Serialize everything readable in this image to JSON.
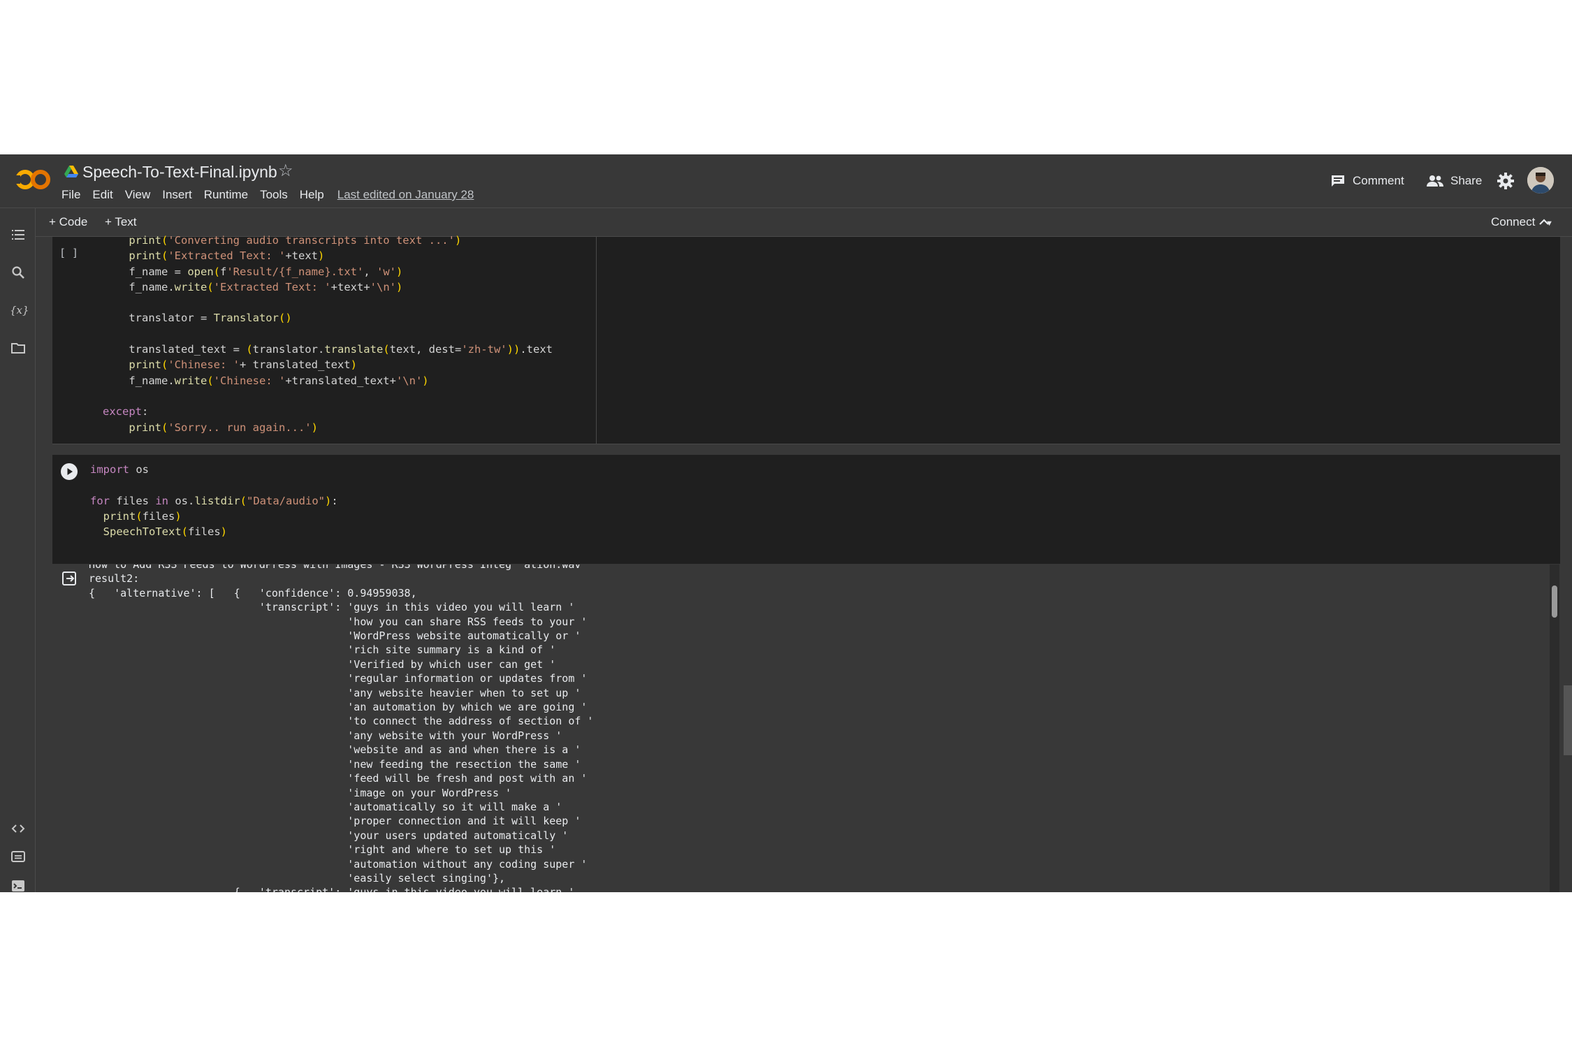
{
  "header": {
    "title": "Speech-To-Text-Final.ipynb",
    "menu": [
      "File",
      "Edit",
      "View",
      "Insert",
      "Runtime",
      "Tools",
      "Help"
    ],
    "last_edited": "Last edited on January 28",
    "comment_label": "Comment",
    "share_label": "Share"
  },
  "toolbar": {
    "code_label": "+ Code",
    "text_label": "+ Text",
    "connect_label": "Connect"
  },
  "cells": {
    "cell1_bracket": "[ ]",
    "cell1_lines": [
      "    print('Converting audio transcripts into text ...')",
      "    print('Extracted Text: '+text)",
      "    f_name = open(f'Result/{f_name}.txt', 'w')",
      "    f_name.write('Extracted Text: '+text+'\\n')",
      "",
      "    translator = Translator()",
      "",
      "    translated_text = (translator.translate(text, dest='zh-tw')).text",
      "    print('Chinese: '+ translated_text)",
      "    f_name.write('Chinese: '+translated_text+'\\n')",
      "",
      "except:",
      "    print('Sorry.. run again...')"
    ],
    "cell2_lines": [
      "import os",
      "",
      "for files in os.listdir(\"Data/audio\"):",
      "  print(files)",
      "  SpeechToText(files)"
    ]
  },
  "output": {
    "lines": [
      "How to Add RSS Feeds to WordPress with Images - RSS WordPress Integ  ation.wav",
      "result2:",
      "{   'alternative': [   {   'confidence': 0.94959038,",
      "                           'transcript': 'guys in this video you will learn '",
      "                                         'how you can share RSS feeds to your '",
      "                                         'WordPress website automatically or '",
      "                                         'rich site summary is a kind of '",
      "                                         'Verified by which user can get '",
      "                                         'regular information or updates from '",
      "                                         'any website heavier when to set up '",
      "                                         'an automation by which we are going '",
      "                                         'to connect the address of section of '",
      "                                         'any website with your WordPress '",
      "                                         'website and as and when there is a '",
      "                                         'new feeding the resection the same '",
      "                                         'feed will be fresh and post with an '",
      "                                         'image on your WordPress '",
      "                                         'automatically so it will make a '",
      "                                         'proper connection and it will keep '",
      "                                         'your users updated automatically '",
      "                                         'right and where to set up this '",
      "                                         'automation without any coding super '",
      "                                         'easily select singing'},",
      "                       {   'transcript': 'guys in this video you will learn '"
    ]
  },
  "colors": {
    "background": "#383838",
    "cell_bg": "#1f1f1f",
    "string": "#ce9178",
    "keyword": "#c586c0",
    "logo_orange": "#f9ab00"
  }
}
